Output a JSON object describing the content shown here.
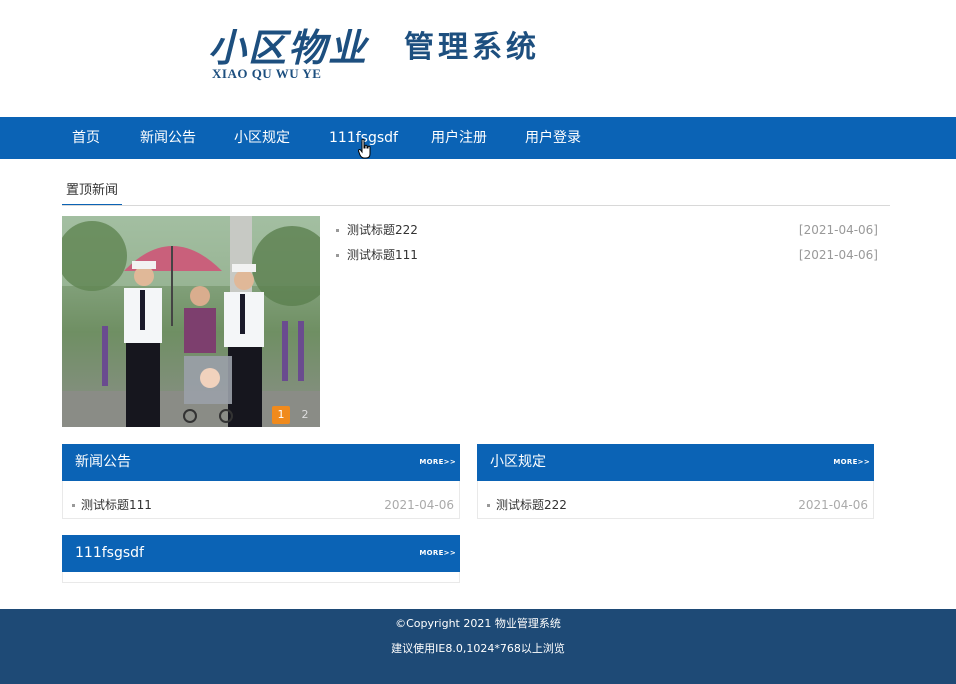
{
  "logo": {
    "script_text": "小区物业",
    "subtitle": "XIAO QU WU YE",
    "main_text": "管理系统",
    "color": "#1d4f7f"
  },
  "nav": {
    "items": [
      {
        "label": "首页"
      },
      {
        "label": "新闻公告"
      },
      {
        "label": "小区规定"
      },
      {
        "label": "111fsgsdf"
      },
      {
        "label": "用户注册"
      },
      {
        "label": "用户登录"
      }
    ],
    "background": "#0b63b5"
  },
  "top_news": {
    "tab_label": "置顶新闻",
    "slideshow": {
      "active_index": "1",
      "next_index": "2"
    },
    "items": [
      {
        "title": "测试标题222",
        "date": "[2021-04-06]"
      },
      {
        "title": "测试标题111",
        "date": "[2021-04-06]"
      }
    ]
  },
  "panels": {
    "news": {
      "title": "新闻公告",
      "more": "MORE>>",
      "items": [
        {
          "title": "测试标题111",
          "date": "2021-04-06"
        }
      ]
    },
    "rules": {
      "title": "小区规定",
      "more": "MORE>>",
      "items": [
        {
          "title": "测试标题222",
          "date": "2021-04-06"
        }
      ]
    },
    "custom": {
      "title": "111fsgsdf",
      "more": "MORE>>",
      "items": []
    }
  },
  "footer": {
    "copyright": "©Copyright 2021 物业管理系统",
    "browser_hint": "建议使用IE8.0,1024*768以上浏览",
    "background": "#1e4a76"
  },
  "icons": {
    "cursor": "hand-pointer-icon",
    "bullet": "square-bullet-icon"
  }
}
